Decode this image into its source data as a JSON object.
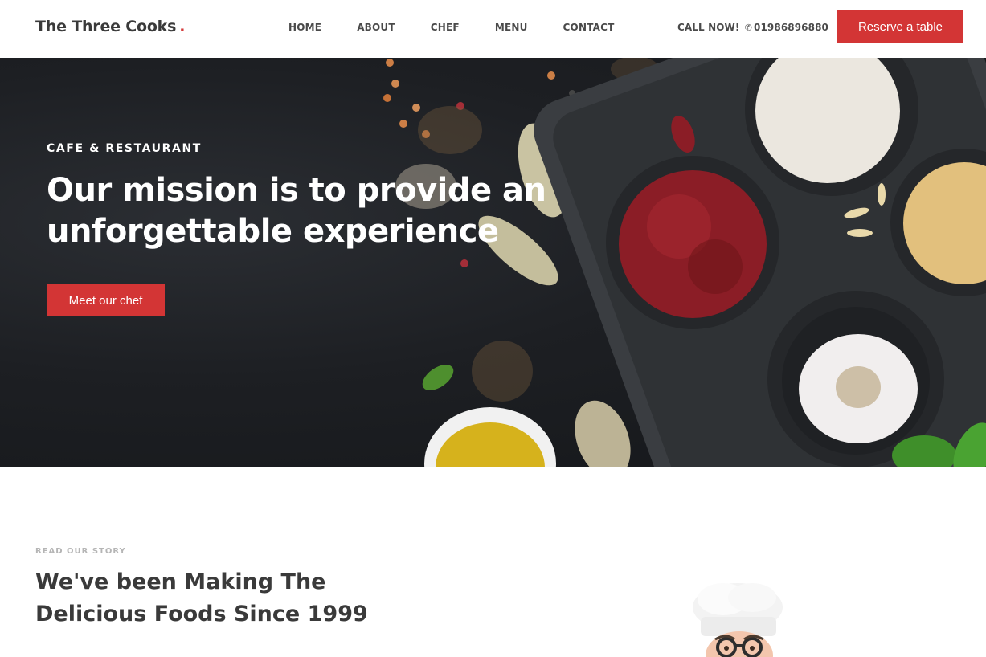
{
  "brand": {
    "name": "The Three Cooks",
    "dot": "."
  },
  "nav": {
    "items": [
      {
        "label": "HOME"
      },
      {
        "label": "ABOUT"
      },
      {
        "label": "CHEF"
      },
      {
        "label": "MENU"
      },
      {
        "label": "CONTACT"
      }
    ]
  },
  "call": {
    "label": "CALL NOW!",
    "icon": "phone-icon",
    "number": "01986896880"
  },
  "reserve": {
    "label": "Reserve a table"
  },
  "hero": {
    "eyebrow": "CAFE & RESTAURANT",
    "title_line1": "Our mission is to provide an",
    "title_line2": "unforgettable experience",
    "cta": "Meet our chef"
  },
  "story": {
    "eyebrow": "READ OUR STORY",
    "title_line1": "We've been Making The",
    "title_line2": "Delicious Foods Since 1999"
  },
  "colors": {
    "accent": "#d33535",
    "hero_bg": "#1d1f23",
    "text_dark": "#3a3a3a"
  }
}
